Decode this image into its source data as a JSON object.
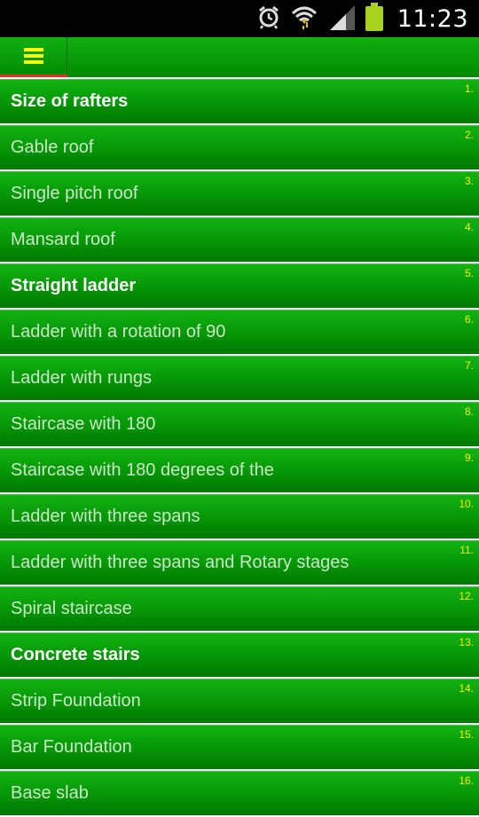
{
  "status_bar": {
    "time": "11:23",
    "icons": [
      "alarm-icon",
      "wifi-icon",
      "signal-icon",
      "battery-icon"
    ],
    "battery_color": "#a8d21e"
  },
  "action_bar": {
    "menu_icon": "hamburger-menu-icon",
    "menu_icon_color": "#ffff00",
    "indicator_color": "#e03030"
  },
  "list": {
    "items": [
      {
        "number": "1.",
        "label": "Size of rafters",
        "is_header": true
      },
      {
        "number": "2.",
        "label": "Gable roof",
        "is_header": false
      },
      {
        "number": "3.",
        "label": "Single pitch roof",
        "is_header": false
      },
      {
        "number": "4.",
        "label": "Mansard roof",
        "is_header": false
      },
      {
        "number": "5.",
        "label": "Straight ladder",
        "is_header": true
      },
      {
        "number": "6.",
        "label": "Ladder with a rotation of 90",
        "is_header": false
      },
      {
        "number": "7.",
        "label": "Ladder with rungs",
        "is_header": false
      },
      {
        "number": "8.",
        "label": "Staircase with 180",
        "is_header": false
      },
      {
        "number": "9.",
        "label": "Staircase with 180 degrees of the",
        "is_header": false
      },
      {
        "number": "10.",
        "label": "Ladder with three spans",
        "is_header": false
      },
      {
        "number": "11.",
        "label": "Ladder with three spans and Rotary stages",
        "is_header": false
      },
      {
        "number": "12.",
        "label": "Spiral staircase",
        "is_header": false
      },
      {
        "number": "13.",
        "label": "Concrete stairs",
        "is_header": true
      },
      {
        "number": "14.",
        "label": "Strip Foundation",
        "is_header": false
      },
      {
        "number": "15.",
        "label": "Bar Foundation",
        "is_header": false
      },
      {
        "number": "16.",
        "label": "Base slab",
        "is_header": false
      }
    ]
  }
}
